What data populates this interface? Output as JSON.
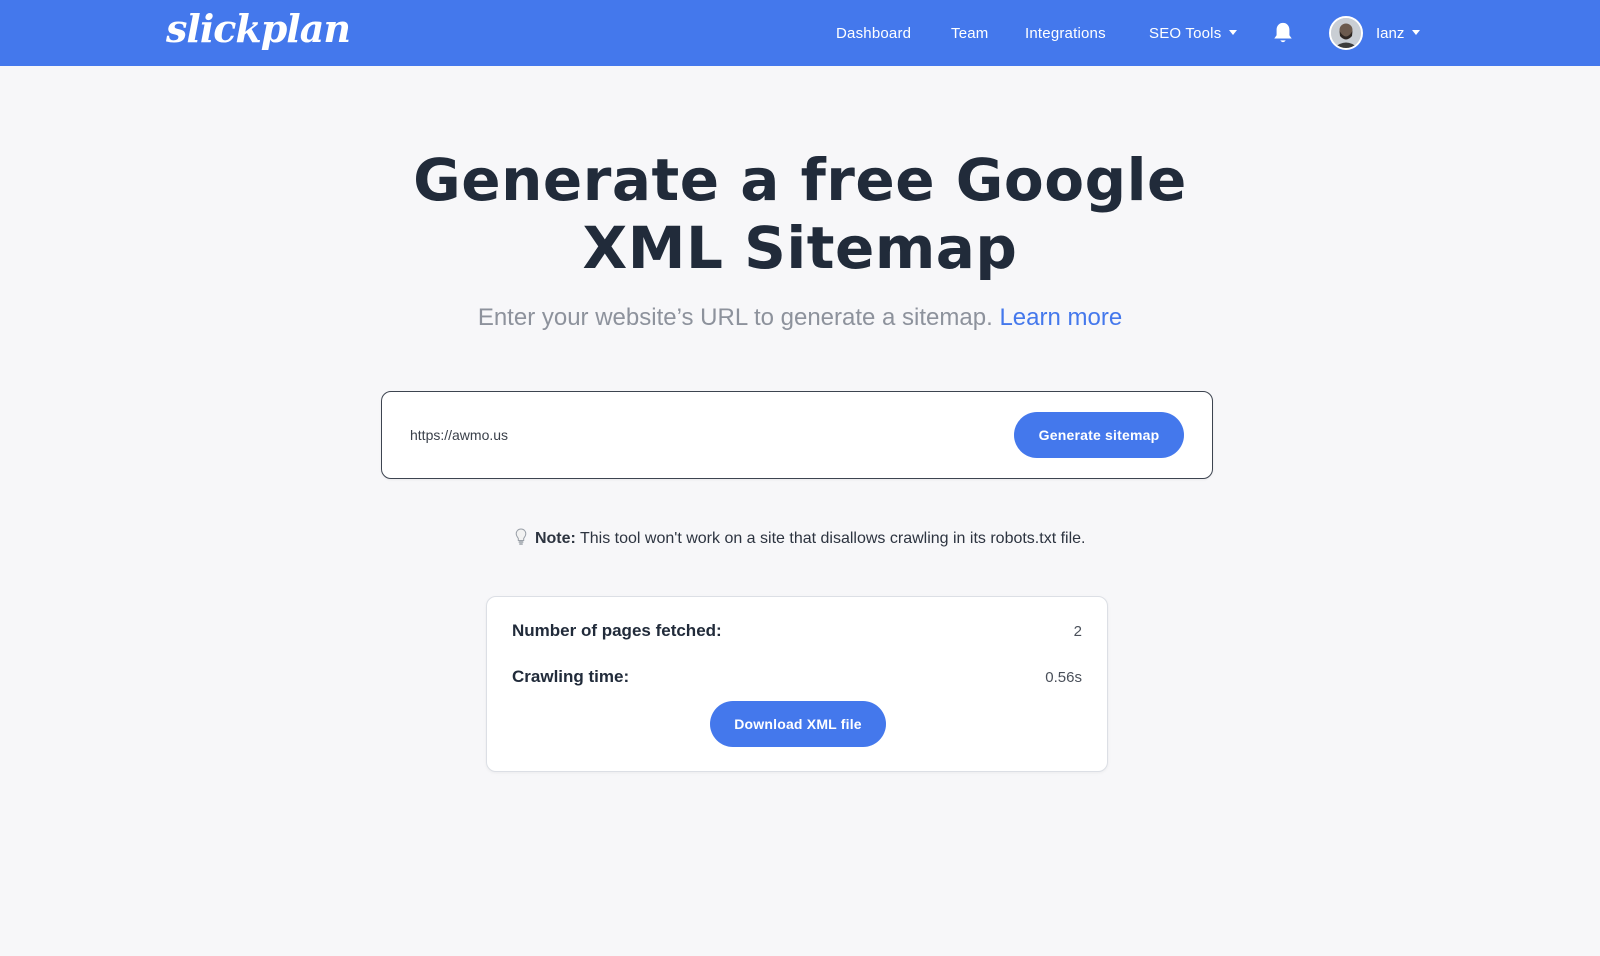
{
  "header": {
    "logo": "slickplan",
    "nav": {
      "dashboard": "Dashboard",
      "team": "Team",
      "integrations": "Integrations",
      "seo_tools": "SEO Tools"
    },
    "user_name": "Ianz"
  },
  "hero": {
    "title_line1": "Generate a free Google",
    "title_line2": "XML Sitemap",
    "subtitle": "Enter your website’s URL to generate a sitemap.",
    "learn_more": "Learn more"
  },
  "form": {
    "url_value": "https://awmo.us",
    "generate_label": "Generate sitemap"
  },
  "note": {
    "label": "Note:",
    "text": "This tool won't work on a site that disallows crawling in its robots.txt file."
  },
  "results": {
    "pages_label": "Number of pages fetched:",
    "pages_value": "2",
    "time_label": "Crawling time:",
    "time_value": "0.56s",
    "download_label": "Download XML file"
  },
  "colors": {
    "brand": "#4478ec",
    "background": "#f7f7f9",
    "heading": "#212b3a",
    "muted": "#8d929c"
  },
  "icons": {
    "notifications": "bell-icon",
    "note": "lightbulb-icon",
    "dropdown": "caret-down-icon"
  }
}
